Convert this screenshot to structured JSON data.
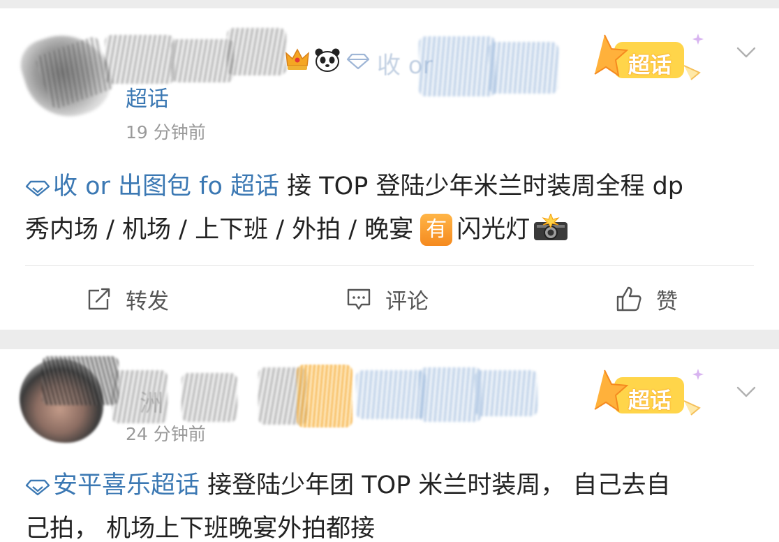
{
  "posts": [
    {
      "name_visible_fragment": "收 or",
      "name_tag": "超话",
      "time": "19 分钟前",
      "badge_label": "超话",
      "content": {
        "topic": "收 or 出图包 fo 超话",
        "text_line1": " 接 TOP 登陆少年米兰时装周全程 dp",
        "text_line2": "秀内场 / 机场 / 上下班 / 外拍 / 晚宴",
        "badge": "有",
        "text_after_badge": "闪光灯"
      },
      "actions": {
        "repost": "转发",
        "comment": "评论",
        "like": "赞"
      }
    },
    {
      "name_visible_fragment": "洲",
      "time": "24 分钟前",
      "badge_label": "超话",
      "content": {
        "topic": "安平喜乐超话",
        "text_line1": " 接登陆少年团 TOP 米兰时装周， 自己去自",
        "text_line2": "己拍， 机场上下班晚宴外拍都接"
      }
    }
  ],
  "icons": {
    "crown": "crown-icon",
    "panda": "panda-icon",
    "diamond": "diamond-icon",
    "chevron": "chevron-down-icon",
    "camera": "camera-flash-icon",
    "repost": "repost-icon",
    "comment": "comment-icon",
    "like": "thumbs-up-icon"
  },
  "colors": {
    "link_blue": "#3b78b3",
    "time_gray": "#9a9a9a",
    "badge_orange": "#f5a623",
    "background": "#ececec"
  }
}
